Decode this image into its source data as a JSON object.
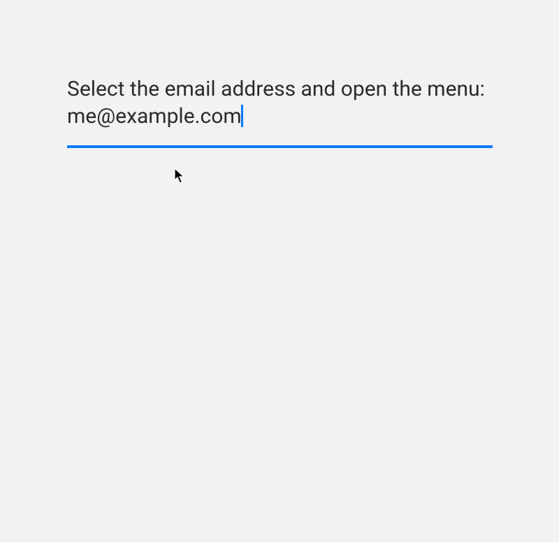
{
  "input": {
    "text": "Select the email address and open the menu: me@example.com"
  },
  "colors": {
    "accent": "#0a7bff",
    "text": "#2b2b2b",
    "background": "#f2f2f2"
  }
}
